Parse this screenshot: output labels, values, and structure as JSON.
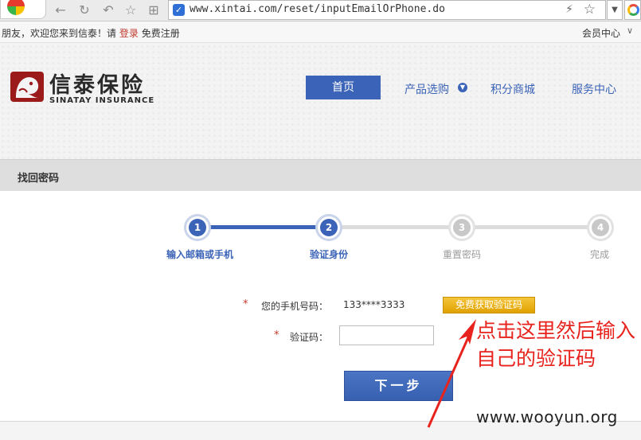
{
  "browser": {
    "url": "www.xintai.com/reset/inputEmailOrPhone.do"
  },
  "topbar": {
    "welcome_prefix": "朋友，欢迎您来到信泰！请",
    "login": "登录",
    "register": "免费注册",
    "member_center": "会员中心"
  },
  "header": {
    "logo_cn": "信泰保险",
    "logo_en": "SINATAY INSURANCE",
    "nav": {
      "home": "首页",
      "products": "产品选购",
      "points_mall": "积分商城",
      "service": "服务中心"
    }
  },
  "panel": {
    "title": "找回密码"
  },
  "steps": [
    {
      "num": "1",
      "label": "输入邮箱或手机",
      "state": "done"
    },
    {
      "num": "2",
      "label": "验证身份",
      "state": "current"
    },
    {
      "num": "3",
      "label": "重置密码",
      "state": "todo"
    },
    {
      "num": "4",
      "label": "完成",
      "state": "todo"
    }
  ],
  "form": {
    "required_mark": "*",
    "phone_label": "您的手机号码：",
    "phone_value": "133****3333",
    "get_code_button": "免费获取验证码",
    "code_label": "验证码：",
    "code_value": "",
    "next_button": "下一步"
  },
  "annotation": {
    "text": "点击这里然后输入自己的验证码",
    "color": "#e8231d"
  },
  "watermark": "www.wooyun.org",
  "colors": {
    "accent": "#3b63b7",
    "button_gold": "#f0b31c"
  }
}
